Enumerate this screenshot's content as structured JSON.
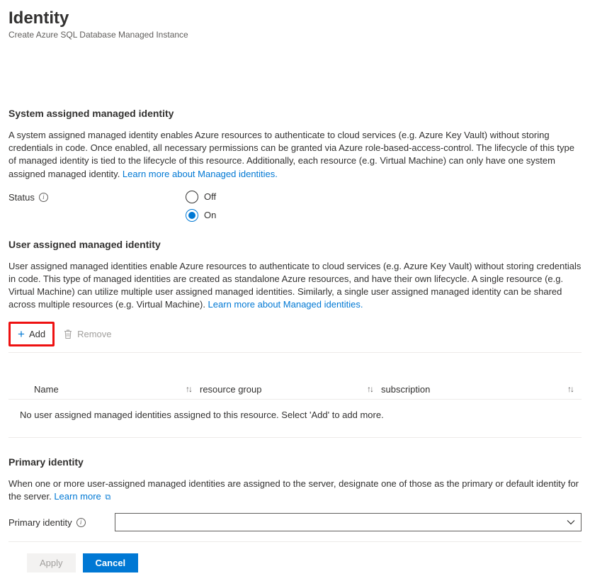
{
  "page": {
    "title": "Identity",
    "subtitle": "Create Azure SQL Database Managed Instance"
  },
  "system_identity": {
    "heading": "System assigned managed identity",
    "description": "A system assigned managed identity enables Azure resources to authenticate to cloud services (e.g. Azure Key Vault) without storing credentials in code. Once enabled, all necessary permissions can be granted via Azure role-based-access-control. The lifecycle of this type of managed identity is tied to the lifecycle of this resource. Additionally, each resource (e.g. Virtual Machine) can only have one system assigned managed identity. ",
    "link_text": "Learn more about Managed identities.",
    "status_label": "Status",
    "options": {
      "off": "Off",
      "on": "On"
    },
    "value": "on"
  },
  "user_identity": {
    "heading": "User assigned managed identity",
    "description": "User assigned managed identities enable Azure resources to authenticate to cloud services (e.g. Azure Key Vault) without storing credentials in code. This type of managed identities are created as standalone Azure resources, and have their own lifecycle. A single resource (e.g. Virtual Machine) can utilize multiple user assigned managed identities. Similarly, a single user assigned managed identity can be shared across multiple resources (e.g. Virtual Machine). ",
    "link_text": "Learn more about Managed identities.",
    "toolbar": {
      "add": "Add",
      "remove": "Remove"
    },
    "columns": {
      "name": "Name",
      "resource_group": "resource group",
      "subscription": "subscription"
    },
    "empty_message": "No user assigned managed identities assigned to this resource. Select 'Add' to add more."
  },
  "primary": {
    "heading": "Primary identity",
    "description": "When one or more user-assigned managed identities are assigned to the server, designate one of those as the primary or default identity for the server. ",
    "link_text": "Learn more",
    "field_label": "Primary identity",
    "value": ""
  },
  "footer": {
    "apply": "Apply",
    "cancel": "Cancel"
  }
}
